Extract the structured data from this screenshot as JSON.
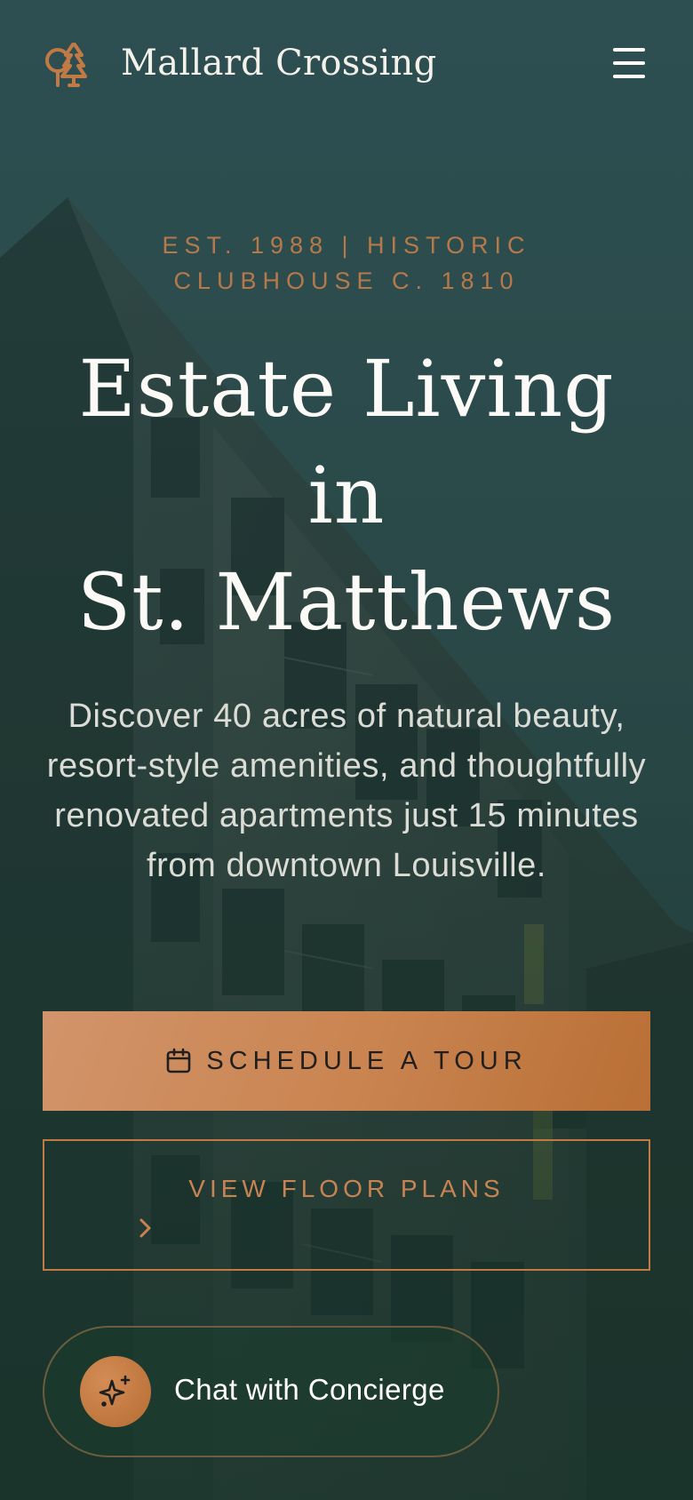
{
  "header": {
    "brand_name": "Mallard Crossing",
    "logo_icon": "trees-icon",
    "menu_icon": "hamburger-menu-icon"
  },
  "hero": {
    "eyebrow_line1": "EST. 1988 | HISTORIC",
    "eyebrow_line2": "CLUBHOUSE C. 1810",
    "headline_line1": "Estate Living",
    "headline_line2": "in",
    "headline_line3": "St. Matthews",
    "subtext": "Discover 40 acres of natural beauty, resort-style amenities, and thoughtfully renovated apartments just 15 minutes from downtown Louisville."
  },
  "actions": {
    "primary_label": "SCHEDULE A TOUR",
    "primary_icon": "calendar-icon",
    "secondary_label": "VIEW FLOOR PLANS",
    "secondary_icon": "chevron-right-icon"
  },
  "chat": {
    "label": "Chat with Concierge",
    "icon": "sparkles-icon"
  },
  "colors": {
    "accent": "#c27a45",
    "background": "#1e3a33",
    "headline": "#fbfaf6"
  }
}
